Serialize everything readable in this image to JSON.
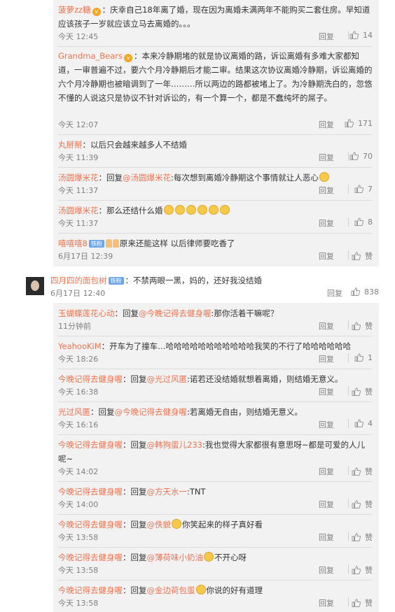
{
  "labels": {
    "reply": "回复"
  },
  "thread1": [
    {
      "user": "菠萝zz糖",
      "vip": true,
      "text": "：庆幸自己18年离了婚，现在因为离婚未满两年不能购买二套住房。早知道应该孩子一岁就应该立马去离婚的。。。",
      "time": "今天 12:45",
      "likes": "14"
    },
    {
      "user": "Grandma_Bears",
      "vip": true,
      "text": "：本来冷静期堵的就是协议离婚的路，诉讼离婚有多难大家都知道，一审普遍不过，要六个月冷静期后才能二审。结果这次协议离婚冷静期，诉讼离婚的六个月冷静期也被暗调到了一年………所以两边的路都被堵上了。为冷静期洗白的，忽悠不懂的人说这只是协议不针对诉讼的，有一个算一个，都是不蠢纯坏的屌子。",
      "time": "今天 12:07",
      "likes": "171"
    },
    {
      "user": "丸掰掰",
      "text": "：以后只会越来越多人不结婚",
      "time": "今天 11:39",
      "likes": "70"
    },
    {
      "user": "汤圆爆米花",
      "reply_prefix": "：回复",
      "mention": "@汤圆爆米花",
      "text": ":每次想到离婚冷静期这个事情就让人恶心",
      "emoji_after": 1,
      "time": "今天 11:37",
      "likes": "7"
    },
    {
      "user": "汤圆爆米花",
      "text": "：那么还结什么婚",
      "emoji_after": 6,
      "time": "今天 11:37",
      "likes": "8"
    },
    {
      "user": "嘻嘻嘻8",
      "badge": "铁粉",
      "thumbs": 2,
      "text": "原来还能这样 以后律师要吃香了",
      "time": "6月17日 12:39",
      "likes": "赞"
    }
  ],
  "top": {
    "user": "四月四的面包树",
    "badge": "铁粉",
    "text": "：不禁两眼一黑，妈的，还好我没结婚",
    "time": "6月17日 12:40",
    "likes": "838"
  },
  "thread2": [
    {
      "user": "玉蝴蝶莲花心动",
      "reply_prefix": "：回复",
      "mention": "@今晚记得去健身喔",
      "text": ":那你活着干嘛呢？",
      "time": "11分钟前",
      "likes": "赞"
    },
    {
      "user": "YeahooKiM",
      "text": "：开车为了撞车…哈哈哈哈哈哈哈哈哈哈哈我笑的不行了哈哈哈哈哈哈",
      "time": "今天 18:26",
      "likes": "1"
    },
    {
      "user": "今晚记得去健身喔",
      "reply_prefix": "：回复",
      "mention": "@光过风匿",
      "text": ":诺若还没结婚就想着离婚，则结婚无意义。",
      "time": "今天 16:38",
      "likes": "赞"
    },
    {
      "user": "光过风匿",
      "reply_prefix": "：回复",
      "mention": "@今晚记得去健身喔",
      "text": ":若离婚无自由，则结婚无意义。",
      "time": "今天 16:16",
      "likes": "4"
    },
    {
      "user": "今晚记得去健身喔",
      "reply_prefix": "：回复",
      "mention": "@韩狗蛋儿233",
      "text": ":我也觉得大家都很有意思呀~都是可爱的人儿呢~",
      "time": "今天 14:02",
      "likes": "赞"
    },
    {
      "user": "今晚记得去健身喔",
      "reply_prefix": "：回复",
      "mention": "@方天水一",
      "text": ":TNT",
      "time": "今天 14:00",
      "likes": "赞"
    },
    {
      "user": "今晚记得去健身喔",
      "reply_prefix": "：回复",
      "mention": "@佚貌",
      "text": "你笑起来的样子真好看",
      "emoji_before": 1,
      "time": "今天 13:58",
      "likes": "赞"
    },
    {
      "user": "今晚记得去健身喔",
      "reply_prefix": "：回复",
      "mention": "@薄荷味小奶油",
      "text": "不开心呀",
      "emoji_before": 1,
      "time": "今天 13:58",
      "likes": "赞"
    },
    {
      "user": "今晚记得去健身喔",
      "reply_prefix": "：回复",
      "mention": "@金边荷包蛋",
      "text": "你说的好有道理",
      "emoji_before": 1,
      "time": "今天 13:58",
      "likes": "赞"
    }
  ],
  "colors": {
    "link": "#eb7350",
    "meta": "#808080",
    "subbg": "#f2f2f2",
    "badge": "#6ca6e8"
  }
}
